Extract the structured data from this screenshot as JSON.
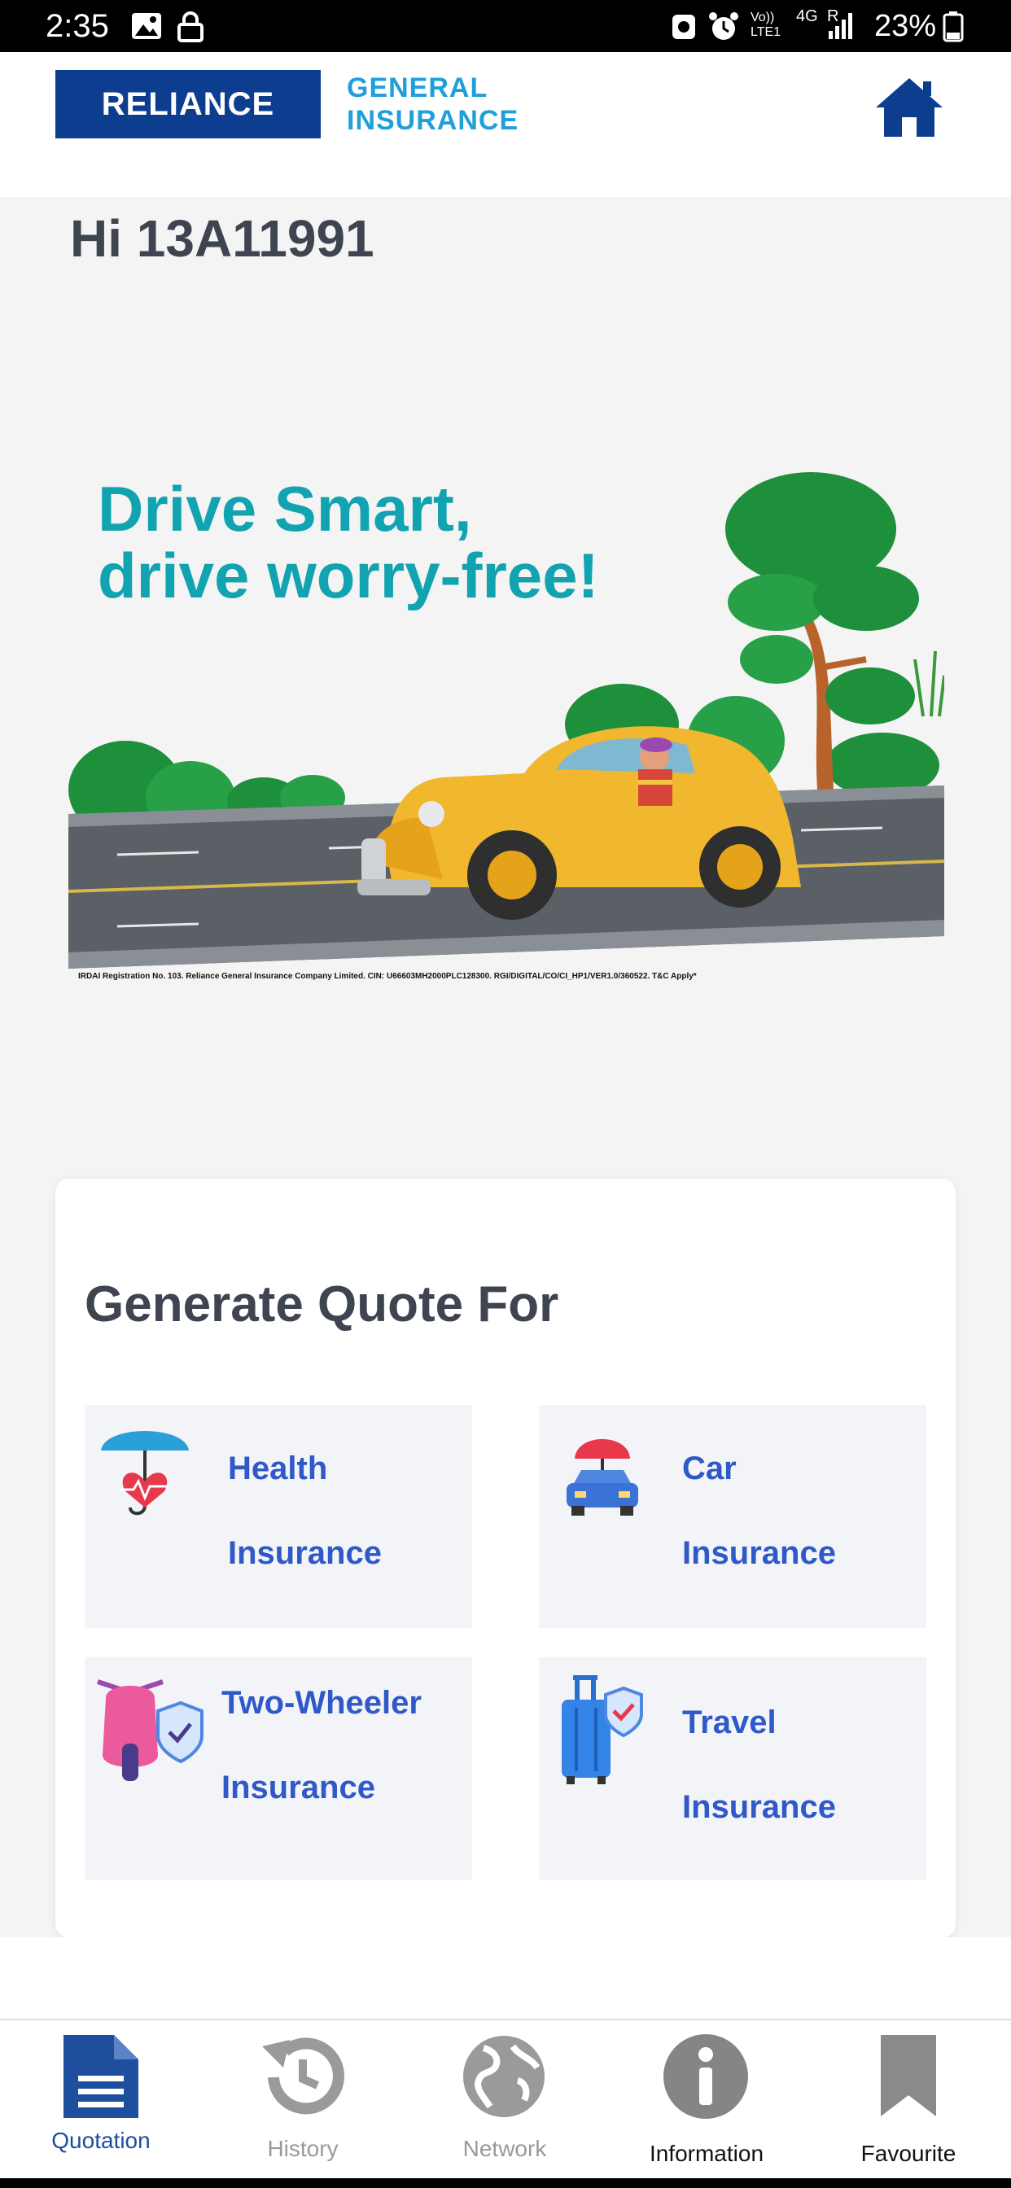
{
  "status_bar": {
    "time": "2:35",
    "network": "4G",
    "volte": "Vo))",
    "lte": "LTE1",
    "roaming": "R",
    "battery": "23%"
  },
  "header": {
    "logo_brand": "RELIANCE",
    "logo_line1": "GENERAL",
    "logo_line2": "INSURANCE"
  },
  "greeting": "Hi 13A11991",
  "banner": {
    "tagline_line1": "Drive Smart,",
    "tagline_line2": "drive worry-free!",
    "disclaimer": "IRDAI Registration No. 103. Reliance General Insurance Company Limited. CIN: U66603MH2000PLC128300. RGI/DIGITAL/CO/CI_HP1/VER1.0/360522. T&C Apply*"
  },
  "quote": {
    "title": "Generate Quote For",
    "tiles": [
      {
        "line1": "Health",
        "line2": "Insurance"
      },
      {
        "line1": "Car",
        "line2": "Insurance"
      },
      {
        "line1": "Two-Wheeler",
        "line2": "Insurance"
      },
      {
        "line1": "Travel",
        "line2": "Insurance"
      }
    ]
  },
  "nav": {
    "items": [
      {
        "label": "Quotation",
        "color": "#1e4f9e"
      },
      {
        "label": "History",
        "color": "#9a9a9a"
      },
      {
        "label": "Network",
        "color": "#9a9a9a"
      },
      {
        "label": "Information",
        "color": "#111111"
      },
      {
        "label": "Favourite",
        "color": "#111111"
      }
    ]
  },
  "colors": {
    "brand_blue": "#0d3d8f",
    "accent_blue": "#2f58c8",
    "teal": "#12a3b0"
  }
}
